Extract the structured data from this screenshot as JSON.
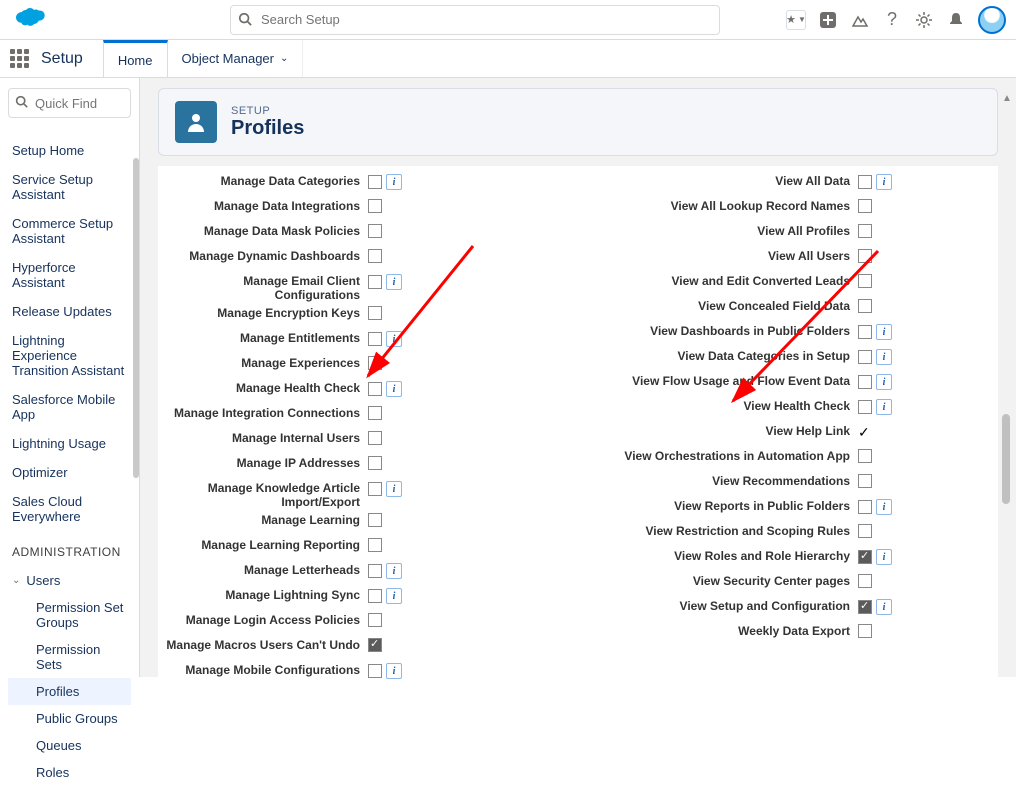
{
  "header": {
    "search_placeholder": "Search Setup",
    "setup_label": "Setup",
    "tabs": [
      {
        "label": "Home",
        "active": true
      },
      {
        "label": "Object Manager",
        "active": false,
        "hasChevron": true
      }
    ]
  },
  "sidebar": {
    "quick_find_placeholder": "Quick Find",
    "links": [
      "Setup Home",
      "Service Setup Assistant",
      "Commerce Setup Assistant",
      "Hyperforce Assistant",
      "Release Updates",
      "Lightning Experience Transition Assistant",
      "Salesforce Mobile App",
      "Lightning Usage",
      "Optimizer",
      "Sales Cloud Everywhere"
    ],
    "admin_header": "ADMINISTRATION",
    "group": {
      "label": "Users",
      "expanded": true
    },
    "subitems": [
      {
        "label": "Permission Set Groups",
        "active": false
      },
      {
        "label": "Permission Sets",
        "active": false
      },
      {
        "label": "Profiles",
        "active": true
      },
      {
        "label": "Public Groups",
        "active": false
      },
      {
        "label": "Queues",
        "active": false
      },
      {
        "label": "Roles",
        "active": false
      }
    ]
  },
  "page": {
    "crumb": "SETUP",
    "title": "Profiles"
  },
  "perms_left": [
    {
      "label": "Manage Data Categories",
      "checked": false,
      "info": true
    },
    {
      "label": "Manage Data Integrations",
      "checked": false,
      "info": false
    },
    {
      "label": "Manage Data Mask Policies",
      "checked": false,
      "info": false
    },
    {
      "label": "Manage Dynamic Dashboards",
      "checked": false,
      "info": false
    },
    {
      "label": "Manage Email Client Configurations",
      "checked": false,
      "info": true
    },
    {
      "label": "Manage Encryption Keys",
      "checked": false,
      "info": false
    },
    {
      "label": "Manage Entitlements",
      "checked": false,
      "info": true
    },
    {
      "label": "Manage Experiences",
      "checked": false,
      "info": false
    },
    {
      "label": "Manage Health Check",
      "checked": false,
      "info": true
    },
    {
      "label": "Manage Integration Connections",
      "checked": false,
      "info": false
    },
    {
      "label": "Manage Internal Users",
      "checked": false,
      "info": false
    },
    {
      "label": "Manage IP Addresses",
      "checked": false,
      "info": false
    },
    {
      "label": "Manage Knowledge Article Import/Export",
      "checked": false,
      "info": true
    },
    {
      "label": "Manage Learning",
      "checked": false,
      "info": false
    },
    {
      "label": "Manage Learning Reporting",
      "checked": false,
      "info": false
    },
    {
      "label": "Manage Letterheads",
      "checked": false,
      "info": true
    },
    {
      "label": "Manage Lightning Sync",
      "checked": false,
      "info": true
    },
    {
      "label": "Manage Login Access Policies",
      "checked": false,
      "info": false
    },
    {
      "label": "Manage Macros Users Can't Undo",
      "checked": true,
      "info": false
    },
    {
      "label": "Manage Mobile Configurations",
      "checked": false,
      "info": true
    }
  ],
  "perms_right": [
    {
      "label": "View All Data",
      "checked": false,
      "info": true
    },
    {
      "label": "View All Lookup Record Names",
      "checked": false,
      "info": false
    },
    {
      "label": "View All Profiles",
      "checked": false,
      "info": false
    },
    {
      "label": "View All Users",
      "checked": false,
      "info": false
    },
    {
      "label": "View and Edit Converted Leads",
      "checked": false,
      "info": false
    },
    {
      "label": "View Concealed Field Data",
      "checked": false,
      "info": false
    },
    {
      "label": "View Dashboards in Public Folders",
      "checked": false,
      "info": true
    },
    {
      "label": "View Data Categories in Setup",
      "checked": false,
      "info": true
    },
    {
      "label": "View Flow Usage and Flow Event Data",
      "checked": false,
      "info": true
    },
    {
      "label": "View Health Check",
      "checked": false,
      "info": true
    },
    {
      "label": "View Help Link",
      "checked": "tick",
      "info": false
    },
    {
      "label": "View Orchestrations in Automation App",
      "checked": false,
      "info": false
    },
    {
      "label": "View Recommendations",
      "checked": false,
      "info": false
    },
    {
      "label": "View Reports in Public Folders",
      "checked": false,
      "info": true
    },
    {
      "label": "View Restriction and Scoping Rules",
      "checked": false,
      "info": false
    },
    {
      "label": "View Roles and Role Hierarchy",
      "checked": true,
      "info": true
    },
    {
      "label": "View Security Center pages",
      "checked": false,
      "info": false
    },
    {
      "label": "View Setup and Configuration",
      "checked": true,
      "info": true
    },
    {
      "label": "Weekly Data Export",
      "checked": false,
      "info": false
    }
  ]
}
